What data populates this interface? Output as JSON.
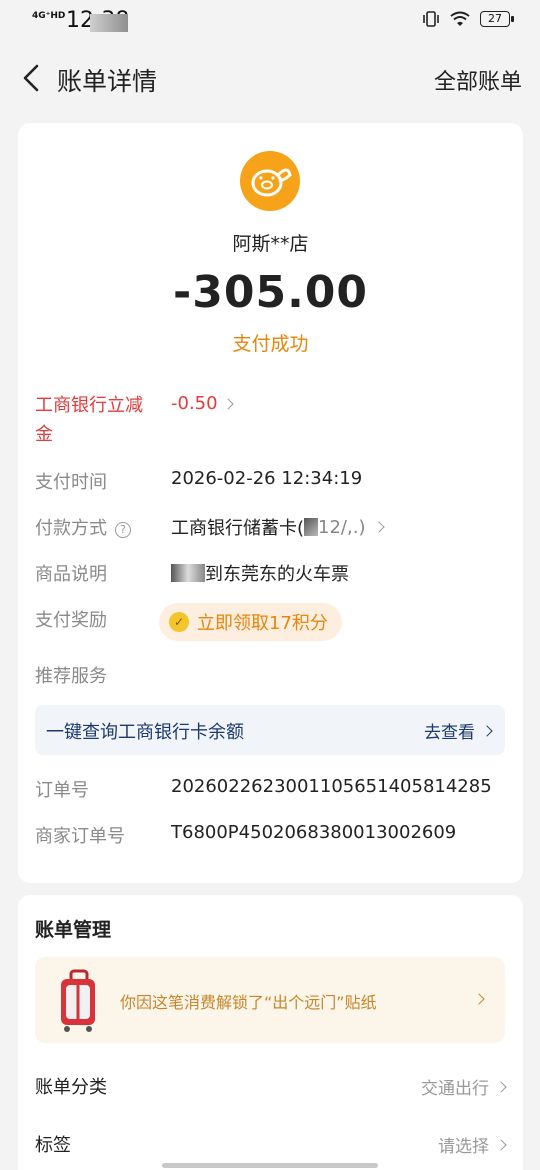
{
  "status_bar": {
    "network": "4G⁺HD",
    "time": "12:38",
    "battery": "27"
  },
  "nav": {
    "title": "账单详情",
    "right_action": "全部账单"
  },
  "merchant": {
    "name": "阿斯**店",
    "amount": "-305.00",
    "status": "支付成功"
  },
  "details": {
    "discount_label": "工商银行立减金",
    "discount_value": "-0.50",
    "pay_time_label": "支付时间",
    "pay_time_value": "2026-02-26 12:34:19",
    "pay_method_label": "付款方式",
    "pay_method_value": "工商银行储蓄卡(",
    "pay_method_suffix": "12/,.)",
    "product_label": "商品说明",
    "product_value": "到东莞东的火车票",
    "reward_label": "支付奖励",
    "reward_text": "立即领取17积分",
    "recommend_label": "推荐服务",
    "service_text": "一键查询工商银行卡余额",
    "service_action": "去查看",
    "order_label": "订单号",
    "order_value": "2026022623001105651405814285",
    "merchant_order_label": "商家订单号",
    "merchant_order_value": "T6800P4502068380013002609"
  },
  "manage": {
    "title": "账单管理",
    "sticker_text": "你因这笔消费解锁了“出个远门”贴纸",
    "category_label": "账单分类",
    "category_value": "交通出行",
    "tag_label": "标签",
    "tag_value": "请选择"
  },
  "colors": {
    "accent_orange": "#e8850a",
    "discount_red": "#e23c3c",
    "service_blue": "#1c3a6e",
    "logo_orange": "#f6a31a"
  }
}
